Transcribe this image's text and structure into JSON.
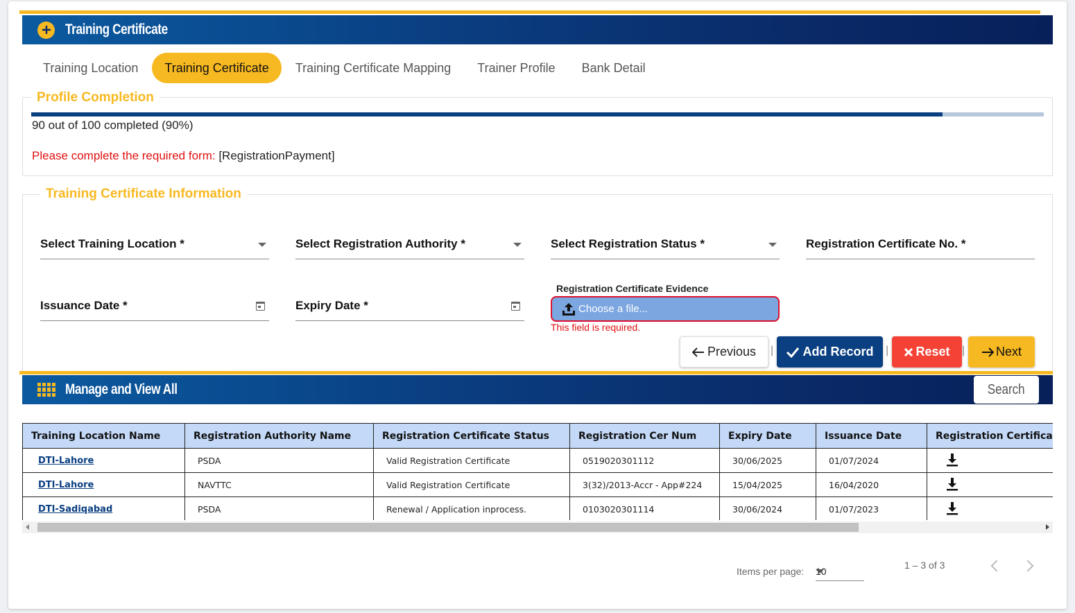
{
  "header": {
    "title": "Training Certificate"
  },
  "tabs": [
    {
      "label": "Training Location",
      "active": false
    },
    {
      "label": "Training Certificate",
      "active": true
    },
    {
      "label": "Training Certificate Mapping",
      "active": false
    },
    {
      "label": "Trainer Profile",
      "active": false
    },
    {
      "label": "Bank Detail",
      "active": false
    }
  ],
  "profile": {
    "legend": "Profile Completion",
    "progress_fraction": 0.9,
    "progress_text": "90 out of 100 completed (90%)",
    "required_label": "Please complete the required form:",
    "required_forms": "[RegistrationPayment]"
  },
  "form": {
    "legend": "Training Certificate Information",
    "training_location": "Select Training Location *",
    "registration_authority": "Select Registration Authority *",
    "registration_status": "Select Registration Status *",
    "certificate_no": "Registration Certificate No. *",
    "issuance_date": "Issuance Date *",
    "expiry_date": "Expiry Date *",
    "evidence_label": "Registration Certificate Evidence",
    "evidence_placeholder": "Choose a file...",
    "evidence_error": "This field is required."
  },
  "buttons": {
    "previous": "Previous",
    "add": "Add Record",
    "reset": "Reset",
    "next": "Next",
    "separator": "|"
  },
  "manage": {
    "title": "Manage and View All",
    "search": "Search"
  },
  "table": {
    "headers": [
      "Training Location Name",
      "Registration Authority Name",
      "Registration Certificate Status",
      "Registration Cer Num",
      "Expiry Date",
      "Issuance Date",
      "Registration Certificat"
    ],
    "rows": [
      {
        "location": "DTI-Lahore",
        "authority": "PSDA",
        "status": "Valid Registration Certificate",
        "cert_num": "0519020301112",
        "expiry": "30/06/2025",
        "issuance": "01/07/2024"
      },
      {
        "location": "DTI-Lahore",
        "authority": "NAVTTC",
        "status": "Valid Registration Certificate",
        "cert_num": "3(32)/2013-Accr - App#224",
        "expiry": "15/04/2025",
        "issuance": "16/04/2020"
      },
      {
        "location": "DTI-Sadiqabad",
        "authority": "PSDA",
        "status": "Renewal / Application inprocess.",
        "cert_num": "0103020301114",
        "expiry": "30/06/2024",
        "issuance": "01/07/2023"
      }
    ]
  },
  "paginator": {
    "items_label": "Items per page:",
    "page_size": "10",
    "range": "1 – 3 of 3"
  },
  "colors": {
    "primary": "#0a3f82",
    "accent": "#f7b921",
    "danger": "#f44336",
    "error_text": "#e01010",
    "header_cell": "#c4d9f7"
  },
  "icons": {
    "header": "plus-circle-icon",
    "manage": "grid-icon",
    "download": "download-icon",
    "upload": "upload-icon",
    "calendar": "calendar-icon"
  }
}
